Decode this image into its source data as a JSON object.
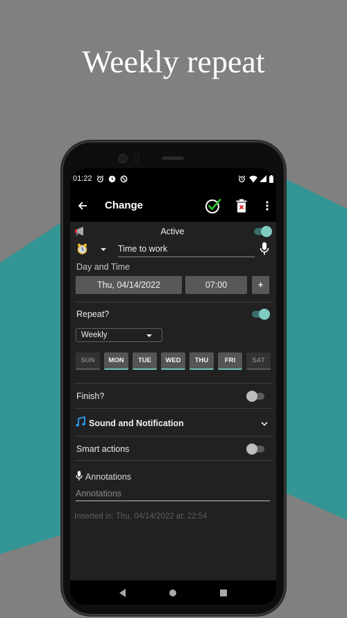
{
  "promo": {
    "title": "Weekly repeat"
  },
  "colors": {
    "teal_bg": "#339694",
    "gray_bg": "#808080",
    "accent": "#7ecbc1",
    "check_green": "#2bbd2b",
    "delete_red": "#e0282e"
  },
  "statusbar": {
    "time": "01:22",
    "left_icons": [
      "alarm-icon",
      "clock-icon",
      "data-saver-icon"
    ],
    "right_icons": [
      "alarm-icon",
      "wifi-icon",
      "signal-icon",
      "battery-icon"
    ]
  },
  "appbar": {
    "title": "Change",
    "back_icon": "arrow-left-icon",
    "actions": [
      "check-circle-icon",
      "delete-icon",
      "more-vert-icon"
    ]
  },
  "form": {
    "active": {
      "label": "Active",
      "icon": "megaphone-icon",
      "enabled": true
    },
    "title_field": {
      "value": "Time to work",
      "icon": "alarm-clock-icon",
      "mic_icon": "mic-icon"
    },
    "day_and_time": {
      "label": "Day and Time",
      "date": "Thu, 04/14/2022",
      "time": "07:00",
      "add_label": "+"
    },
    "repeat": {
      "label": "Repeat?",
      "enabled": true,
      "frequency": "Weekly",
      "days": [
        {
          "label": "SUN",
          "selected": false
        },
        {
          "label": "MON",
          "selected": true
        },
        {
          "label": "TUE",
          "selected": true
        },
        {
          "label": "WED",
          "selected": true
        },
        {
          "label": "THU",
          "selected": true
        },
        {
          "label": "FRI",
          "selected": true
        },
        {
          "label": "SAT",
          "selected": false
        }
      ]
    },
    "finish": {
      "label": "Finish?",
      "enabled": false
    },
    "sound": {
      "label": "Sound and Notification",
      "icon": "music-note-icon",
      "expanded": false
    },
    "smart_actions": {
      "label": "Smart actions",
      "enabled": false
    },
    "annotations": {
      "label": "Annotations",
      "placeholder": "Annotations",
      "value": ""
    },
    "inserted": "Inserted in: Thu, 04/14/2022 at: 22:54"
  },
  "navbar": {
    "buttons": [
      "back",
      "home",
      "recents"
    ]
  }
}
